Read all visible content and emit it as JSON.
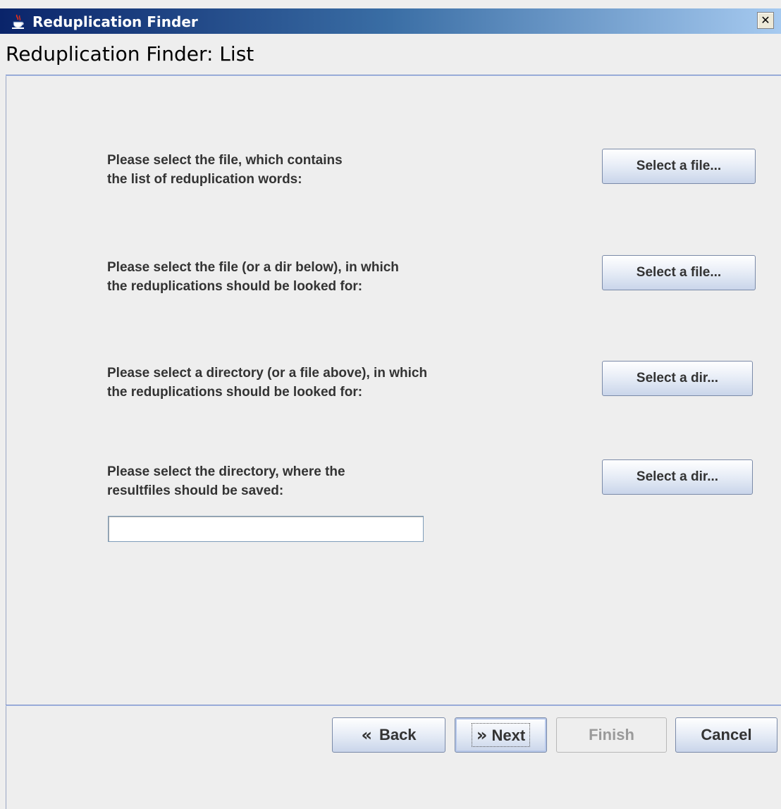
{
  "window": {
    "title": "Reduplication Finder",
    "close_glyph": "✕"
  },
  "page": {
    "title": "Reduplication Finder: List"
  },
  "rows": [
    {
      "prompt_line1": "Please select the file, which contains",
      "prompt_line2": "the list of reduplication words:",
      "button": "Select a file..."
    },
    {
      "prompt_line1": "Please select the file (or a dir below), in which",
      "prompt_line2": "the reduplications should be looked for:",
      "button": "Select a file..."
    },
    {
      "prompt_line1": "Please select a directory (or a file above), in which",
      "prompt_line2": "the reduplications should be looked for:",
      "button": "Select a dir..."
    },
    {
      "prompt_line1": "Please select the directory, where the",
      "prompt_line2": "resultfiles should be saved:",
      "button": "Select a dir..."
    }
  ],
  "result_dir_input": {
    "value": "",
    "placeholder": ""
  },
  "nav": {
    "back_label": "Back",
    "next_label": "Next",
    "finish_label": "Finish",
    "cancel_label": "Cancel",
    "back_icon": "«",
    "next_icon": "»"
  },
  "colors": {
    "titlebar_start": "#0a246a",
    "titlebar_end": "#a6caf0",
    "separator": "#6b84c4",
    "background": "#eeeeee"
  }
}
